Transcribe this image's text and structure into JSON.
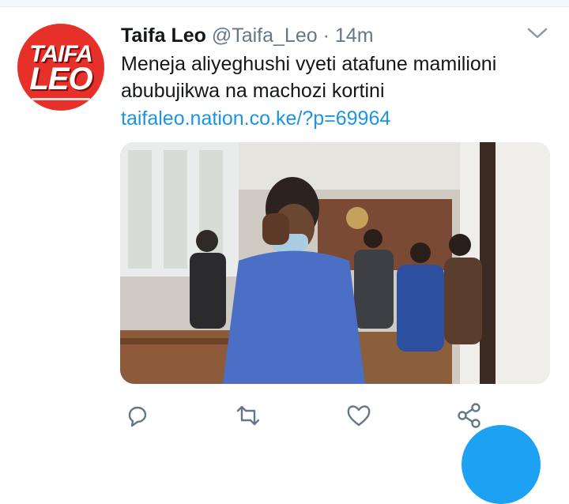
{
  "tweet": {
    "author_name": "Taifa Leo",
    "author_handle": "@Taifa_Leo",
    "separator": "·",
    "time": "14m",
    "text": "Meneja aliyeghushi vyeti atafune mamilioni abubujikwa na machozi kortini",
    "link": "taifaleo.nation.co.ke/?p=69964"
  },
  "avatar": {
    "logo_line1": "TAIFA",
    "logo_line2": "LEO",
    "brand_color": "#e8302a"
  },
  "colors": {
    "accent": "#1b95e0",
    "muted": "#657786",
    "fab": "#1da1f2"
  },
  "icons": [
    "reply-icon",
    "retweet-icon",
    "like-icon",
    "share-icon",
    "caret-down-icon"
  ]
}
